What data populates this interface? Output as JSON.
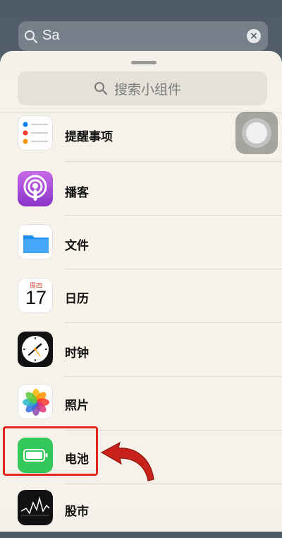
{
  "top_search": {
    "value": "Sa",
    "clear_glyph": "×"
  },
  "widget_search": {
    "placeholder": "搜索小组件"
  },
  "widgets": [
    {
      "label": "提醒事项",
      "icon": "reminders-icon"
    },
    {
      "label": "播客",
      "icon": "podcasts-icon"
    },
    {
      "label": "文件",
      "icon": "files-icon"
    },
    {
      "label": "日历",
      "icon": "calendar-icon",
      "weekday": "周四",
      "day": "17"
    },
    {
      "label": "时钟",
      "icon": "clock-icon"
    },
    {
      "label": "照片",
      "icon": "photos-icon"
    },
    {
      "label": "电池",
      "icon": "battery-icon"
    },
    {
      "label": "股市",
      "icon": "stocks-icon"
    }
  ],
  "colors": {
    "highlight": "#e1261c",
    "battery_green": "#34c759",
    "arrow_red": "#c9221a"
  }
}
